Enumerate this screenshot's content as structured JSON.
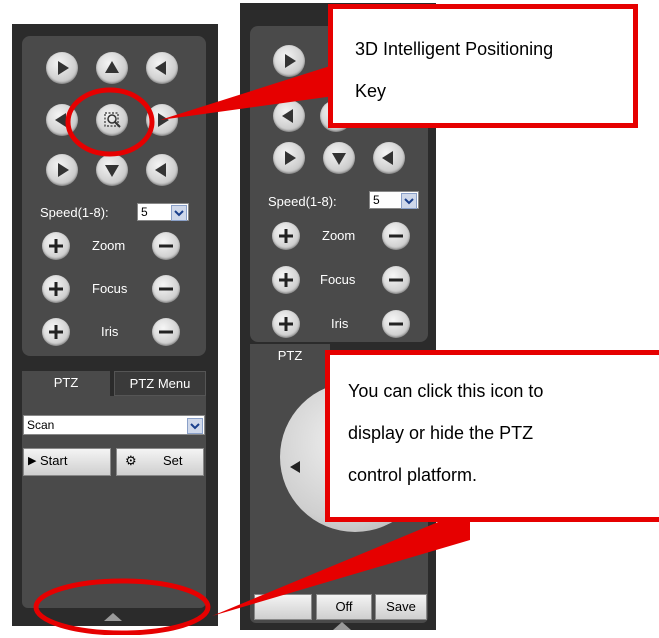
{
  "left_panel": {
    "speed_label": "Speed(1-8):",
    "speed_value": "5",
    "zoom_label": "Zoom",
    "focus_label": "Focus",
    "iris_label": "Iris",
    "tabs": [
      "PTZ",
      "PTZ Menu"
    ],
    "mode_value": "Scan",
    "start_label": "Start",
    "set_label": "Set"
  },
  "right_panel": {
    "speed_label": "Speed(1-8):",
    "speed_value": "5",
    "zoom_label": "Zoom",
    "focus_label": "Focus",
    "iris_label": "Iris",
    "tab_label": "PTZ",
    "off_label": "Off",
    "save_label": "Save"
  },
  "callouts": {
    "top": {
      "line1": "3D Intelligent Positioning",
      "line2": "Key"
    },
    "bottom": {
      "line1": "You can click this icon to",
      "line2": "display or hide the PTZ",
      "line3": "control platform."
    }
  },
  "colors": {
    "annotation": "#e60000",
    "panel_bg": "#2b2b2b",
    "panel_inner": "#4a4a4a"
  }
}
